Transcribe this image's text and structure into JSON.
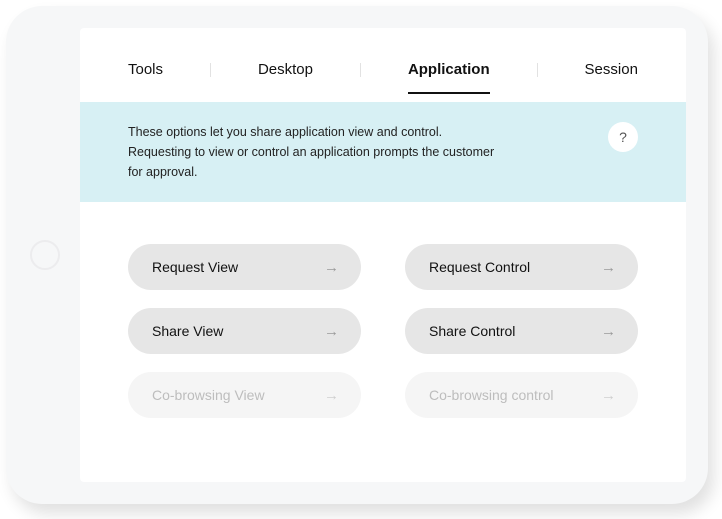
{
  "tabs": [
    {
      "label": "Tools",
      "active": false
    },
    {
      "label": "Desktop",
      "active": false
    },
    {
      "label": "Application",
      "active": true
    },
    {
      "label": "Session",
      "active": false
    }
  ],
  "banner": {
    "text": "These options let you share application view and control. Requesting to view or control an application prompts the customer for approval.",
    "help_label": "?"
  },
  "actions": [
    {
      "label": "Request View",
      "enabled": true
    },
    {
      "label": "Request Control",
      "enabled": true
    },
    {
      "label": "Share View",
      "enabled": true
    },
    {
      "label": "Share Control",
      "enabled": true
    },
    {
      "label": "Co-browsing View",
      "enabled": false
    },
    {
      "label": "Co-browsing control",
      "enabled": false
    }
  ],
  "icons": {
    "arrow_right": "→"
  }
}
